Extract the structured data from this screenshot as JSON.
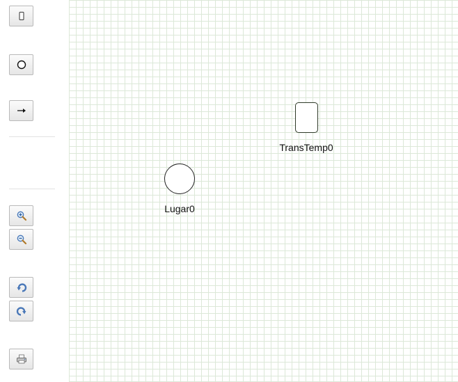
{
  "toolbar": {
    "groups": [
      {
        "items": [
          {
            "name": "transition-tool",
            "icon": "transition-rect-icon"
          },
          {
            "name": "place-tool",
            "icon": "place-circle-icon"
          },
          {
            "name": "arc-tool",
            "icon": "arrow-right-icon"
          }
        ]
      },
      {
        "items": [
          {
            "name": "zoom-in",
            "icon": "zoom-in-icon"
          },
          {
            "name": "zoom-out",
            "icon": "zoom-out-icon"
          }
        ]
      },
      {
        "items": [
          {
            "name": "undo",
            "icon": "undo-icon"
          },
          {
            "name": "redo",
            "icon": "redo-icon"
          }
        ]
      },
      {
        "items": [
          {
            "name": "print",
            "icon": "printer-icon"
          }
        ]
      }
    ]
  },
  "canvas": {
    "grid": true,
    "grid_color": "#dce8d8",
    "nodes": [
      {
        "type": "place",
        "label": "Lugar0"
      },
      {
        "type": "transition",
        "label": "TransTemp0"
      }
    ]
  },
  "colors": {
    "button_border": "#b9b9b9",
    "icon_blue": "#4a78b8",
    "node_stroke": "#222222"
  }
}
